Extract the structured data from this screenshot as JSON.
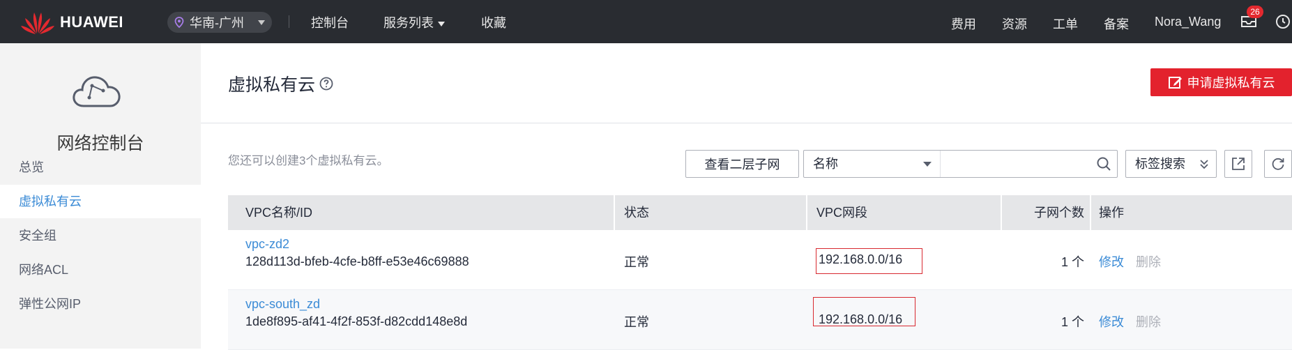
{
  "header": {
    "logo_text": "HUAWEI",
    "region": "华南-广州",
    "nav": [
      {
        "label": "控制台"
      },
      {
        "label": "服务列表"
      },
      {
        "label": "收藏"
      }
    ],
    "right_nav": [
      {
        "label": "费用"
      },
      {
        "label": "资源"
      },
      {
        "label": "工单"
      },
      {
        "label": "备案"
      }
    ],
    "user": "Nora_Wang",
    "mail_badge": "26",
    "colors": {
      "bar": "#292c31",
      "badge": "#e4292f"
    }
  },
  "sidebar": {
    "title": "网络控制台",
    "icon": "cloud-network-icon",
    "items": [
      {
        "label": "总览"
      },
      {
        "label": "虚拟私有云",
        "active": true
      },
      {
        "label": "安全组"
      },
      {
        "label": "网络ACL"
      },
      {
        "label": "弹性公网IP"
      }
    ]
  },
  "main": {
    "title": "虚拟私有云",
    "create_button": "申请虚拟私有云",
    "hint": "您还可以创建3个虚拟私有云。",
    "view_subnet_button": "查看二层子网",
    "search": {
      "field": "名称",
      "placeholder": "",
      "value": ""
    },
    "tag_search": "标签搜索",
    "accent_color": "#e3222d",
    "link_color": "#3b8bd6"
  },
  "table": {
    "headers": [
      "VPC名称/ID",
      "状态",
      "VPC网段",
      "子网个数",
      "操作"
    ],
    "rows": [
      {
        "name": "vpc-zd2",
        "id": "128d113d-bfeb-4cfe-b8ff-e53e46c69888",
        "status": "正常",
        "cidr": "192.168.0.0/16",
        "subnets": "1 个",
        "modify": "修改",
        "delete": "删除"
      },
      {
        "name": "vpc-south_zd",
        "id": "1de8f895-af41-4f2f-853f-d82cdd148e8d",
        "status": "正常",
        "cidr": "192.168.0.0/16",
        "subnets": "1 个",
        "modify": "修改",
        "delete": "删除"
      }
    ]
  }
}
